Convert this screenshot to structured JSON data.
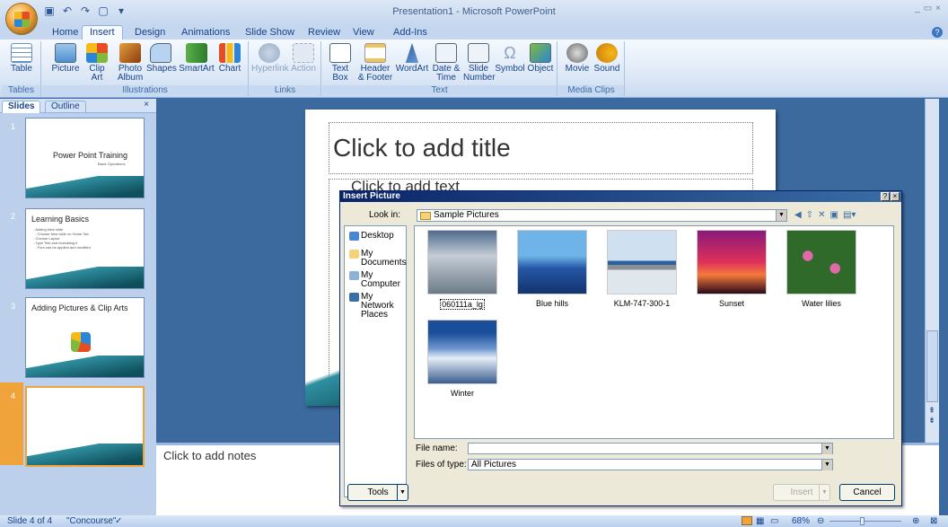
{
  "app": {
    "title": "Presentation1 - Microsoft PowerPoint",
    "window_controls": [
      "_",
      "▭",
      "×"
    ]
  },
  "tabs": [
    "Home",
    "Insert",
    "Design",
    "Animations",
    "Slide Show",
    "Review",
    "View",
    "Add-Ins"
  ],
  "active_tab": "Insert",
  "ribbon": {
    "groups": [
      {
        "label": "Tables",
        "buttons": [
          {
            "label": "Table",
            "icon": "table-icon"
          }
        ]
      },
      {
        "label": "Illustrations",
        "buttons": [
          {
            "label": "Picture",
            "icon": "picture-icon"
          },
          {
            "label": "Clip Art",
            "icon": "clip-art-icon"
          },
          {
            "label": "Photo Album",
            "icon": "photo-album-icon"
          },
          {
            "label": "Shapes",
            "icon": "shapes-icon"
          },
          {
            "label": "SmartArt",
            "icon": "smartart-icon"
          },
          {
            "label": "Chart",
            "icon": "chart-icon"
          }
        ]
      },
      {
        "label": "Links",
        "buttons": [
          {
            "label": "Hyperlink",
            "icon": "hyperlink-icon"
          },
          {
            "label": "Action",
            "icon": "action-icon"
          }
        ]
      },
      {
        "label": "Text",
        "buttons": [
          {
            "label": "Text Box",
            "icon": "text-box-icon"
          },
          {
            "label": "Header & Footer",
            "icon": "header-footer-icon"
          },
          {
            "label": "WordArt",
            "icon": "wordart-icon"
          },
          {
            "label": "Date & Time",
            "icon": "date-time-icon"
          },
          {
            "label": "Slide Number",
            "icon": "slide-number-icon"
          },
          {
            "label": "Symbol",
            "icon": "symbol-icon"
          },
          {
            "label": "Object",
            "icon": "object-icon"
          }
        ]
      },
      {
        "label": "Media Clips",
        "buttons": [
          {
            "label": "Movie",
            "icon": "movie-icon"
          },
          {
            "label": "Sound",
            "icon": "sound-icon"
          }
        ]
      }
    ]
  },
  "left_pane": {
    "tabs": [
      "Slides",
      "Outline"
    ],
    "close": "×",
    "slides": [
      {
        "num": "1",
        "title": "Power Point Training",
        "sub": "Basic Operations"
      },
      {
        "num": "2",
        "title": "Learning Basics",
        "bullets": "- Adding New slide\n  - Choose New slide on Home Tab\n- Choose Layout\n- Type Text and formatting it\n  - Font can be applied and modified"
      },
      {
        "num": "3",
        "title": "Adding Pictures & Clip Arts"
      },
      {
        "num": "4",
        "title": ""
      }
    ]
  },
  "slide": {
    "title_placeholder": "Click to add title",
    "body_placeholder": "Click to add text"
  },
  "notes": {
    "placeholder": "Click to add notes"
  },
  "status": {
    "slide_info": "Slide 4 of 4",
    "theme": "\"Concourse\"",
    "zoom": "68%"
  },
  "dialog": {
    "title": "Insert Picture",
    "look_in_label": "Look in:",
    "look_in_value": "Sample Pictures",
    "places": [
      "Desktop",
      "My Documents",
      "My Computer",
      "My Network Places"
    ],
    "files": [
      {
        "name": "060111a_lg",
        "selected": true
      },
      {
        "name": "Blue hills"
      },
      {
        "name": "KLM-747-300-1"
      },
      {
        "name": "Sunset"
      },
      {
        "name": "Water lilies"
      },
      {
        "name": "Winter"
      }
    ],
    "file_name_label": "File name:",
    "file_name_value": "",
    "files_of_type_label": "Files of type:",
    "files_of_type_value": "All Pictures",
    "tools_label": "Tools",
    "insert_label": "Insert",
    "cancel_label": "Cancel"
  },
  "colors": {
    "ribbon_text": "#15428b",
    "workspace": "#3d6a9e",
    "dialog_title": "#0a246a",
    "selected_slide": "#f0a33a"
  }
}
